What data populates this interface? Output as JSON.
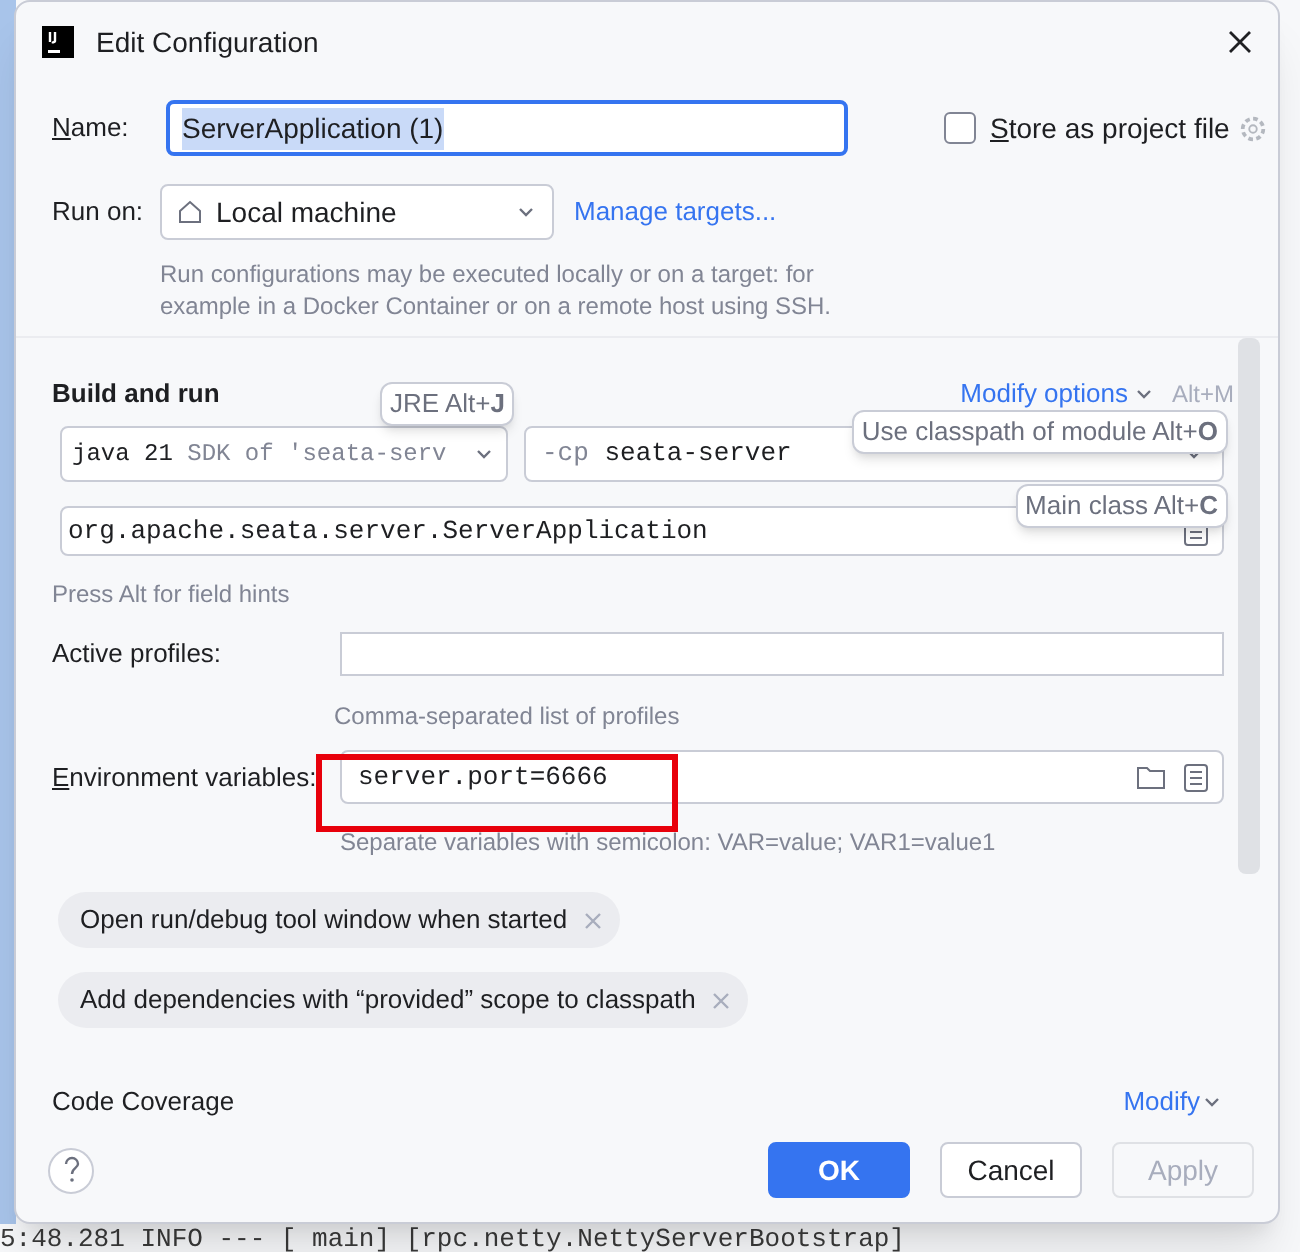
{
  "window": {
    "title": "Edit Configuration"
  },
  "name_field": {
    "label": "Name:",
    "value": "ServerApplication (1)",
    "focused": true
  },
  "store_as_project_file": {
    "label": "Store as project file",
    "checked": false
  },
  "run_on": {
    "label": "Run on:",
    "value": "Local machine",
    "link": "Manage targets...",
    "hint": "Run configurations may be executed locally or on a target: for example in a Docker Container or on a remote host using SSH."
  },
  "build_and_run": {
    "title": "Build and run",
    "modify_options": "Modify options",
    "modify_shortcut": "Alt+M",
    "jre": {
      "value": "java 21",
      "detail": "SDK of 'seata-serv",
      "hint_badge": "JRE Alt+**J**"
    },
    "classpath": {
      "prefix": "-cp",
      "value": "seata-server",
      "hint_badge": "Use classpath of module Alt+**O**"
    },
    "main_class": {
      "value": "org.apache.seata.server.ServerApplication",
      "hint_badge": "Main class Alt+**C**"
    },
    "field_hints": "Press Alt for field hints"
  },
  "active_profiles": {
    "label": "Active profiles:",
    "hint": "Comma-separated list of profiles"
  },
  "environment_variables": {
    "label": "Environment variables:",
    "value": "server.port=6666",
    "highlighted": true,
    "hint": "Separate variables with semicolon: VAR=value; VAR1=value1"
  },
  "options": [
    {
      "label": "Open run/debug tool window when started"
    },
    {
      "label": "Add dependencies with “provided” scope to classpath"
    }
  ],
  "code_coverage": {
    "title": "Code Coverage",
    "modify": "Modify"
  },
  "buttons": [
    {
      "label": "OK",
      "kind": "primary"
    },
    {
      "label": "Cancel",
      "kind": "default"
    },
    {
      "label": "Apply",
      "kind": "disabled"
    }
  ],
  "background_console": {
    "line": "5:48.281  INFO --- [            main] [rpc.netty.NettyServerBootstrap]"
  }
}
